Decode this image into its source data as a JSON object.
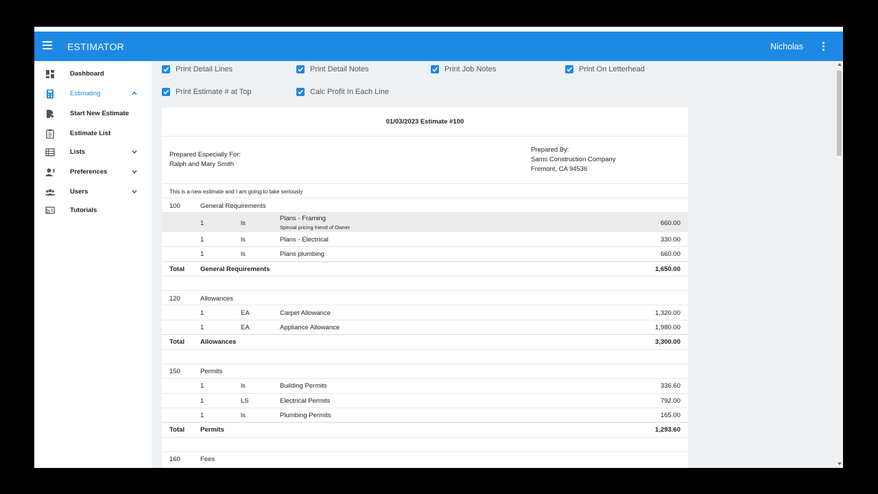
{
  "app": {
    "title": "ESTIMATOR",
    "user": "Nicholas"
  },
  "sidebar": {
    "items": [
      {
        "label": "Dashboard",
        "icon": "dashboard-icon"
      },
      {
        "label": "Estimating",
        "icon": "calculator-icon",
        "expanded": true
      },
      {
        "label": "Start New Estimate",
        "icon": "new-document-icon"
      },
      {
        "label": "Estimate List",
        "icon": "clipboard-list-icon"
      },
      {
        "label": "Lists",
        "icon": "list-icon"
      },
      {
        "label": "Preferences",
        "icon": "user-settings-icon"
      },
      {
        "label": "Users",
        "icon": "users-icon"
      },
      {
        "label": "Tutorials",
        "icon": "cast-icon"
      }
    ]
  },
  "options": {
    "print_detail_lines": "Print Detail Lines",
    "print_detail_notes": "Print Detail Notes",
    "print_job_notes": "Print Job Notes",
    "print_on_letterhead": "Print On Letterhead",
    "print_estimate_top": "Print Estimate # at Top",
    "calc_profit": "Calc Profit In Each Line"
  },
  "estimate": {
    "heading": "01/03/2023 Estimate #100",
    "prepared_for_label": "Prepared Especially For:",
    "prepared_for_name": "Ralph and Mary Smith",
    "prepared_by_label": "Prepared By:",
    "prepared_by_company": "Sams Construction Company",
    "prepared_by_city": "Fremont, CA 94536",
    "note": "This is a new estimate and I am going to take seriously",
    "total_label": "Total",
    "sections": [
      {
        "code": "100",
        "name": "General Requirements",
        "lines": [
          {
            "qty": "1",
            "unit": "ls",
            "desc": "Plans - Framing",
            "note": "Special pricing friend of Owner",
            "amount": "660.00"
          },
          {
            "qty": "1",
            "unit": "ls",
            "desc": "Plans - Electrical",
            "amount": "330.00"
          },
          {
            "qty": "1",
            "unit": "ls",
            "desc": "Plans plumbing",
            "amount": "660.00"
          }
        ],
        "total": "1,650.00"
      },
      {
        "code": "120",
        "name": "Allowances",
        "lines": [
          {
            "qty": "1",
            "unit": "EA",
            "desc": "Carpet Allowance",
            "amount": "1,320.00"
          },
          {
            "qty": "1",
            "unit": "EA",
            "desc": "Appliance Allowance",
            "amount": "1,980.00"
          }
        ],
        "total": "3,300.00"
      },
      {
        "code": "150",
        "name": "Permits",
        "lines": [
          {
            "qty": "1",
            "unit": "ls",
            "desc": "Building Permits",
            "amount": "336.60"
          },
          {
            "qty": "1",
            "unit": "LS",
            "desc": "Electrical Permits",
            "amount": "792.00"
          },
          {
            "qty": "1",
            "unit": "ls",
            "desc": "Plumbing Permits",
            "amount": "165.00"
          }
        ],
        "total": "1,293.60"
      },
      {
        "code": "160",
        "name": "Fees"
      }
    ]
  },
  "colors": {
    "primary": "#1e88e5",
    "background": "#eef1f4",
    "row_highlight": "#ececec"
  }
}
